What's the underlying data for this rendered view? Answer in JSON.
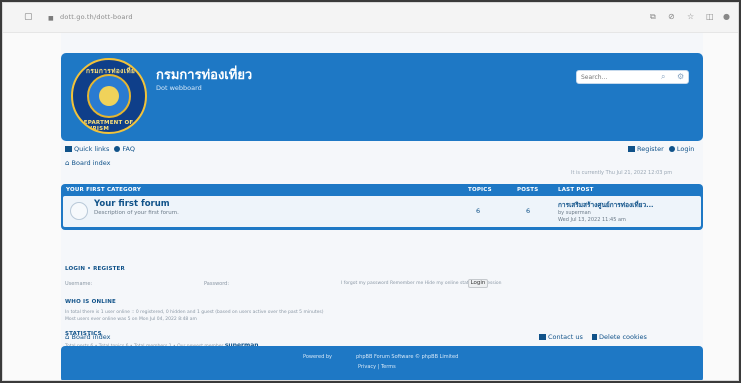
{
  "browser": {
    "url": "dott.go.th/dott-board",
    "icons": [
      "page-icon",
      "lock-icon",
      "translate-icon",
      "zoom-icon",
      "star-icon",
      "sidebar-icon",
      "profile-icon"
    ]
  },
  "header": {
    "site_title": "กรมการท่องเที่ยว",
    "site_desc": "Dot webboard",
    "search_placeholder": "Search…",
    "logo_top_text": "กรมการท่องเที่ยว",
    "logo_bottom_text": "DEPARTMENT OF TOURISM"
  },
  "nav": {
    "quick_links": "Quick links",
    "faq": "FAQ",
    "register": "Register",
    "login": "Login",
    "board_index": "Board index",
    "datetime": "It is currently Thu Jul 21, 2022 12:03 pm"
  },
  "forum_table": {
    "headers": {
      "category": "YOUR FIRST CATEGORY",
      "topics": "TOPICS",
      "posts": "POSTS",
      "last_post": "LAST POST"
    },
    "rows": [
      {
        "title": "Your first forum",
        "description": "Description of your first forum.",
        "topics": "6",
        "posts": "6",
        "last_post_title": "การเสริมสร้างศูนย์การท่องเที่ยว...",
        "last_post_by": "by superman",
        "last_post_date": "Wed Jul 13, 2022 11:45 am"
      }
    ]
  },
  "login_section": {
    "heading": "LOGIN • REGISTER",
    "username_label": "Username:",
    "password_label": "Password:",
    "remember_text": "I forgot my password   Remember me   Hide my online status this session",
    "login_button": "Login"
  },
  "whos_online": {
    "heading": "WHO IS ONLINE",
    "line1": "In total there is 1 user online :: 0 registered, 0 hidden and 1 guest (based on users active over the past 5 minutes)",
    "line2": "Most users ever online was 5 on Mon Jul 04, 2022 8:48 am"
  },
  "statistics": {
    "heading": "STATISTICS",
    "text": "Total posts 6 • Total topics 6 • Total members 1 • Our newest member",
    "newest_member": "superman"
  },
  "footer": {
    "board_index": "Board index",
    "contact_us": "Contact us",
    "delete_cookies": "Delete cookies",
    "powered_by": "Powered by",
    "phpbb_text": "phpBB Forum Software © phpBB Limited",
    "privacy_terms": "Privacy | Terms"
  }
}
